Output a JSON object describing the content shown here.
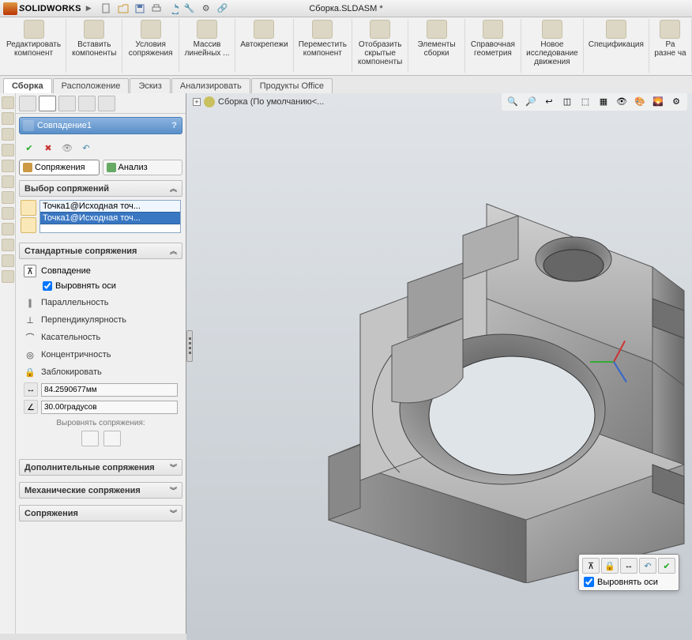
{
  "app": {
    "logo_text_s": "S",
    "logo_text_rest": "OLIDWORKS",
    "doc_title": "Сборка.SLDASM *"
  },
  "ribbon": [
    {
      "label": "Редактировать компонент"
    },
    {
      "label": "Вставить компоненты"
    },
    {
      "label": "Условия сопряжения"
    },
    {
      "label": "Массив линейных ..."
    },
    {
      "label": "Автокрепежи"
    },
    {
      "label": "Переместить компонент"
    },
    {
      "label": "Отобразить скрытые компоненты"
    },
    {
      "label": "Элементы сборки"
    },
    {
      "label": "Справочная геометрия"
    },
    {
      "label": "Новое исследование движения"
    },
    {
      "label": "Спецификация"
    },
    {
      "label": "Ра\nразне\nча"
    }
  ],
  "tabs": [
    {
      "label": "Сборка",
      "active": true
    },
    {
      "label": "Расположение"
    },
    {
      "label": "Эскиз"
    },
    {
      "label": "Анализировать"
    },
    {
      "label": "Продукты Office"
    }
  ],
  "feature": {
    "name": "Совпадение1",
    "help": "?"
  },
  "subtabs": {
    "mates": "Сопряжения",
    "analysis": "Анализ"
  },
  "sections": {
    "selection": "Выбор сопряжений",
    "standard": "Стандартные сопряжения",
    "advanced": "Дополнительные сопряжения",
    "mechanical": "Механические сопряжения",
    "mates_list": "Сопряжения"
  },
  "selections": [
    "Точка1@Исходная точ...",
    "Точка1@Исходная точ..."
  ],
  "mates": {
    "coincident": "Совпадение",
    "align_axes": "Выровнять оси",
    "parallel": "Параллельность",
    "perpendicular": "Перпендикулярность",
    "tangent": "Касательность",
    "concentric": "Концентричность",
    "lock": "Заблокировать"
  },
  "dims": {
    "distance": "84.2590677мм",
    "angle": "30.00градусов"
  },
  "align_label": "Выровнять сопряжения:",
  "crumb": {
    "label": "Сборка  (По умолчанию<..."
  },
  "popup": {
    "align_axes": "Выровнять оси"
  }
}
